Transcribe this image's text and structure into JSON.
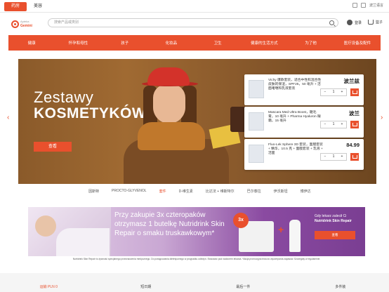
{
  "topbar": {
    "tab_pharmacy": "药房",
    "tab_beauty": "美容",
    "right_label": "波兰语言"
  },
  "header": {
    "logo_top": "Apteka",
    "logo_name": "Gemini",
    "search_placeholder": "搜索产品或类别",
    "account_label": "登录",
    "cart_label": "篮子"
  },
  "nav": {
    "items": [
      "健康",
      "怀孕和母性",
      "孩子",
      "化妆品",
      "卫生",
      "健康的生活方式",
      "为了他",
      "医疗设备及配件"
    ]
  },
  "hero": {
    "title_line1": "Zestawy",
    "title_line2": "KOSMETYKÓW",
    "cta": "查看",
    "products": [
      {
        "name": "Vichy 爆款套装，适合中性和混合性皮肤的保湿，SPF25，50 毫升 + 洁面啫喱和乳液套装",
        "price": "波兰兹",
        "qty": "1"
      },
      {
        "name": "Mascara Med Ultra Boost，睫毛膏，10 毫升 + Pharma Hyaluron 眼霜，15 毫升",
        "price": "波兰",
        "qty": "1"
      },
      {
        "name": "Fluo-Lek Sphere 3D 套装，面膜套装 + 精华，10.5 克 + 面膜套装 + 乳液 + 洁面",
        "price": "84.99",
        "qty": "1"
      }
    ]
  },
  "slider_tabs": [
    "因斯特",
    "PROCTO-GLYVENOL",
    "套件",
    "D-维生素",
    "比达法 + 维斯特尔",
    "巴尔泰拉",
    "伊沃斯坦",
    "博伊达"
  ],
  "promo": {
    "text": "Przy zakupie 3x czteropaków otrzymasz 1 butelkę Nutridrink Skin Repair o smaku truskawkowym*",
    "badge": "3x",
    "side_line1": "Gdy lekarz zalecił Ci",
    "side_line2": "Nutridrink Skin Repair",
    "cta": "查看"
  },
  "disclaimer": "Nutridrink Skin Repair to żywność specjalnego przeznaczenia medycznego. Do postępowania dietetycznego w przypadku odleżyn. Stosować pod nadzorem lekarza. *Akcja promocyjna trwa do wyczerpania zapasów. Szczegóły w regulaminie.",
  "footer": {
    "items": [
      "运输 PLN 0",
      "短日期",
      "最后一件",
      "多件装"
    ]
  },
  "colors": {
    "accent": "#e9502d",
    "promo_purple": "#7a3e92"
  }
}
